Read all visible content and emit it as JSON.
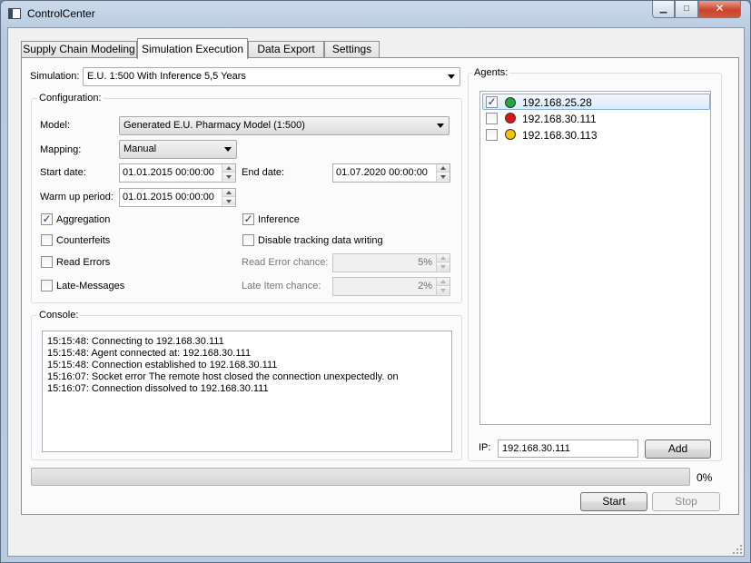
{
  "window": {
    "title": "ControlCenter",
    "min_glyph": "▁",
    "max_glyph": "□",
    "close_glyph": "✕"
  },
  "tabs": [
    {
      "label": "Supply Chain Modeling",
      "active": false
    },
    {
      "label": "Simulation Execution",
      "active": true
    },
    {
      "label": "Data Export",
      "active": false
    },
    {
      "label": "Settings",
      "active": false
    }
  ],
  "simulation": {
    "label": "Simulation:",
    "value": "E.U. 1:500 With Inference 5,5 Years"
  },
  "configuration": {
    "title": "Configuration:",
    "model": {
      "label": "Model:",
      "value": "Generated E.U. Pharmacy Model (1:500)"
    },
    "mapping": {
      "label": "Mapping:",
      "value": "Manual"
    },
    "start_date": {
      "label": "Start date:",
      "value": "01.01.2015 00:00:00"
    },
    "end_date": {
      "label": "End date:",
      "value": "01.07.2020 00:00:00"
    },
    "warm_up": {
      "label": "Warm up period:",
      "value": "01.01.2015 00:00:00"
    },
    "aggregation": {
      "label": "Aggregation",
      "checked": true
    },
    "inference": {
      "label": "Inference",
      "checked": true
    },
    "counterfeits": {
      "label": "Counterfeits",
      "checked": false
    },
    "disable_tracking": {
      "label": "Disable tracking data writing",
      "checked": false
    },
    "read_errors": {
      "label": "Read Errors",
      "checked": false
    },
    "late_messages": {
      "label": "Late-Messages",
      "checked": false
    },
    "read_error_chance": {
      "label": "Read Error chance:",
      "value": "5%"
    },
    "late_item_chance": {
      "label": "Late Item chance:",
      "value": "2%"
    }
  },
  "console": {
    "title": "Console:",
    "lines": [
      "15:15:48: Connecting to 192.168.30.111",
      "15:15:48: Agent connected at: 192.168.30.111",
      "15:15:48: Connection established to 192.168.30.111",
      "15:16:07: Socket error The remote host closed the connection unexpectedly. on",
      "15:16:07: Connection dissolved to 192.168.30.111"
    ]
  },
  "agents": {
    "title": "Agents:",
    "items": [
      {
        "ip": "192.168.25.28",
        "checked": true,
        "status_color": "#22a83a",
        "selected": true
      },
      {
        "ip": "192.168.30.111",
        "checked": false,
        "status_color": "#e01515",
        "selected": false
      },
      {
        "ip": "192.168.30.113",
        "checked": false,
        "status_color": "#f2c500",
        "selected": false
      }
    ],
    "ip_label": "IP:",
    "ip_value": "192.168.30.111",
    "add_label": "Add"
  },
  "progress": {
    "value": 0,
    "label": "0%"
  },
  "actions": {
    "start_label": "Start",
    "stop_label": "Stop",
    "stop_enabled": false
  },
  "icons": {
    "check": "✓",
    "titlebar_icon": "window-app-icon",
    "resize_grip": "resize-grip-icon"
  }
}
